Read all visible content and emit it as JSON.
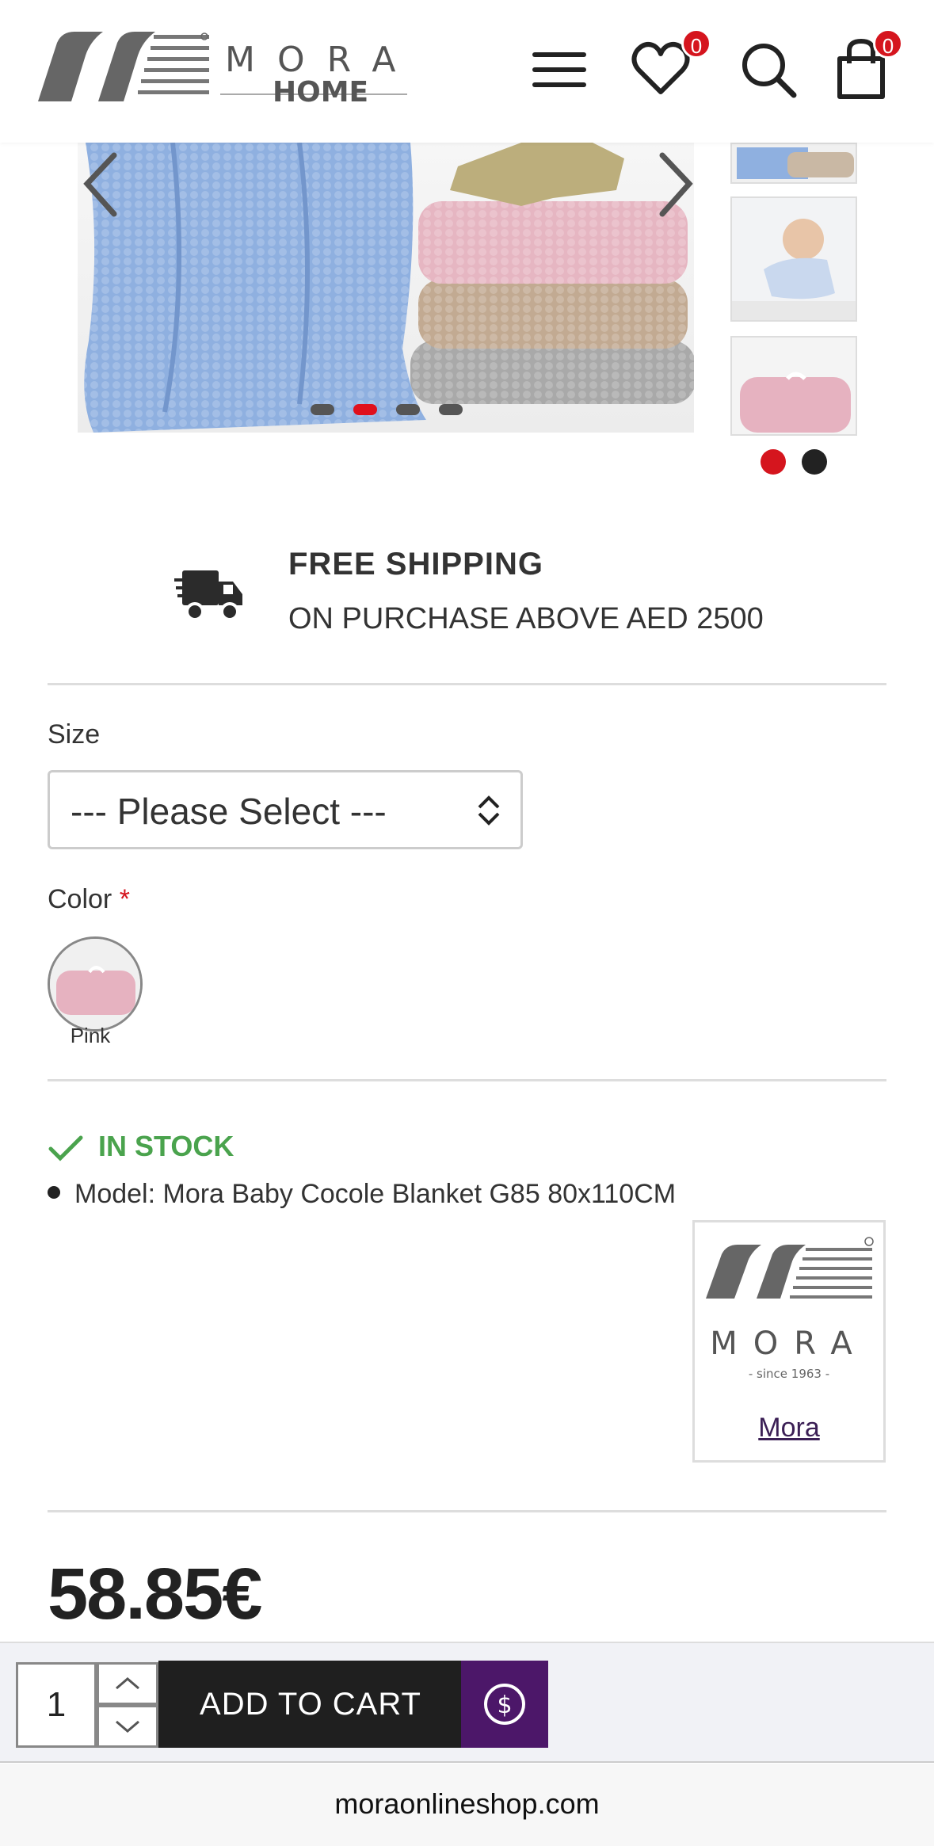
{
  "header": {
    "logo": {
      "brand": "MORA",
      "sub": "HOME"
    },
    "wishlist_count": "0",
    "cart_count": "0",
    "icons": [
      "menu-icon",
      "heart-icon",
      "search-icon",
      "shopping-bag-icon"
    ]
  },
  "gallery": {
    "main_dots": 4,
    "active_main_dot": 1,
    "thumb_dots": 2,
    "active_thumb_dot": 0
  },
  "shipping": {
    "title": "FREE SHIPPING",
    "subtitle": "ON PURCHASE ABOVE AED 2500"
  },
  "options": {
    "size_label": "Size",
    "size_placeholder": "--- Please Select ---",
    "color_label": "Color",
    "color_required": "*",
    "color_swatches": [
      {
        "label": "Pink"
      }
    ]
  },
  "stock": {
    "status": "IN STOCK",
    "model": "Model: Mora Baby Cocole Blanket G85 80x110CM"
  },
  "brand": {
    "logo_word": "MORA",
    "logo_since": "- since 1963 -",
    "link": "Mora"
  },
  "price": "58.85€",
  "cart": {
    "quantity": "1",
    "add_label": "ADD TO CART"
  },
  "browser": {
    "url": "moraonlineshop.com"
  },
  "colors": {
    "accent_red": "#d5151e",
    "stock_green": "#4aa34d",
    "buy_purple": "#4c1769",
    "cart_dark": "#1f1f1f"
  }
}
